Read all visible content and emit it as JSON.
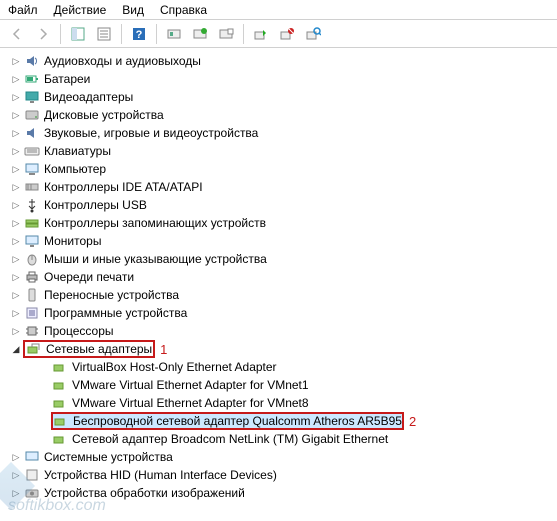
{
  "menu": {
    "file": "Файл",
    "action": "Действие",
    "view": "Вид",
    "help": "Справка"
  },
  "tree": {
    "items": [
      {
        "label": "Аудиовходы и аудиовыходы"
      },
      {
        "label": "Батареи"
      },
      {
        "label": "Видеоадаптеры"
      },
      {
        "label": "Дисковые устройства"
      },
      {
        "label": "Звуковые, игровые и видеоустройства"
      },
      {
        "label": "Клавиатуры"
      },
      {
        "label": "Компьютер"
      },
      {
        "label": "Контроллеры IDE ATA/ATAPI"
      },
      {
        "label": "Контроллеры USB"
      },
      {
        "label": "Контроллеры запоминающих устройств"
      },
      {
        "label": "Мониторы"
      },
      {
        "label": "Мыши и иные указывающие устройства"
      },
      {
        "label": "Очереди печати"
      },
      {
        "label": "Переносные устройства"
      },
      {
        "label": "Программные устройства"
      },
      {
        "label": "Процессоры"
      },
      {
        "label": "Сетевые адаптеры"
      },
      {
        "label": "Системные устройства"
      },
      {
        "label": "Устройства HID (Human Interface Devices)"
      },
      {
        "label": "Устройства обработки изображений"
      }
    ],
    "network_children": [
      {
        "label": "VirtualBox Host-Only Ethernet Adapter"
      },
      {
        "label": "VMware Virtual Ethernet Adapter for VMnet1"
      },
      {
        "label": "VMware Virtual Ethernet Adapter for VMnet8"
      },
      {
        "label": "Беспроводной сетевой адаптер Qualcomm Atheros AR5B95"
      },
      {
        "label": "Сетевой адаптер Broadcom NetLink (TM) Gigabit Ethernet"
      }
    ]
  },
  "annotations": {
    "a1": "1",
    "a2": "2"
  },
  "watermark": "softikbox.com"
}
